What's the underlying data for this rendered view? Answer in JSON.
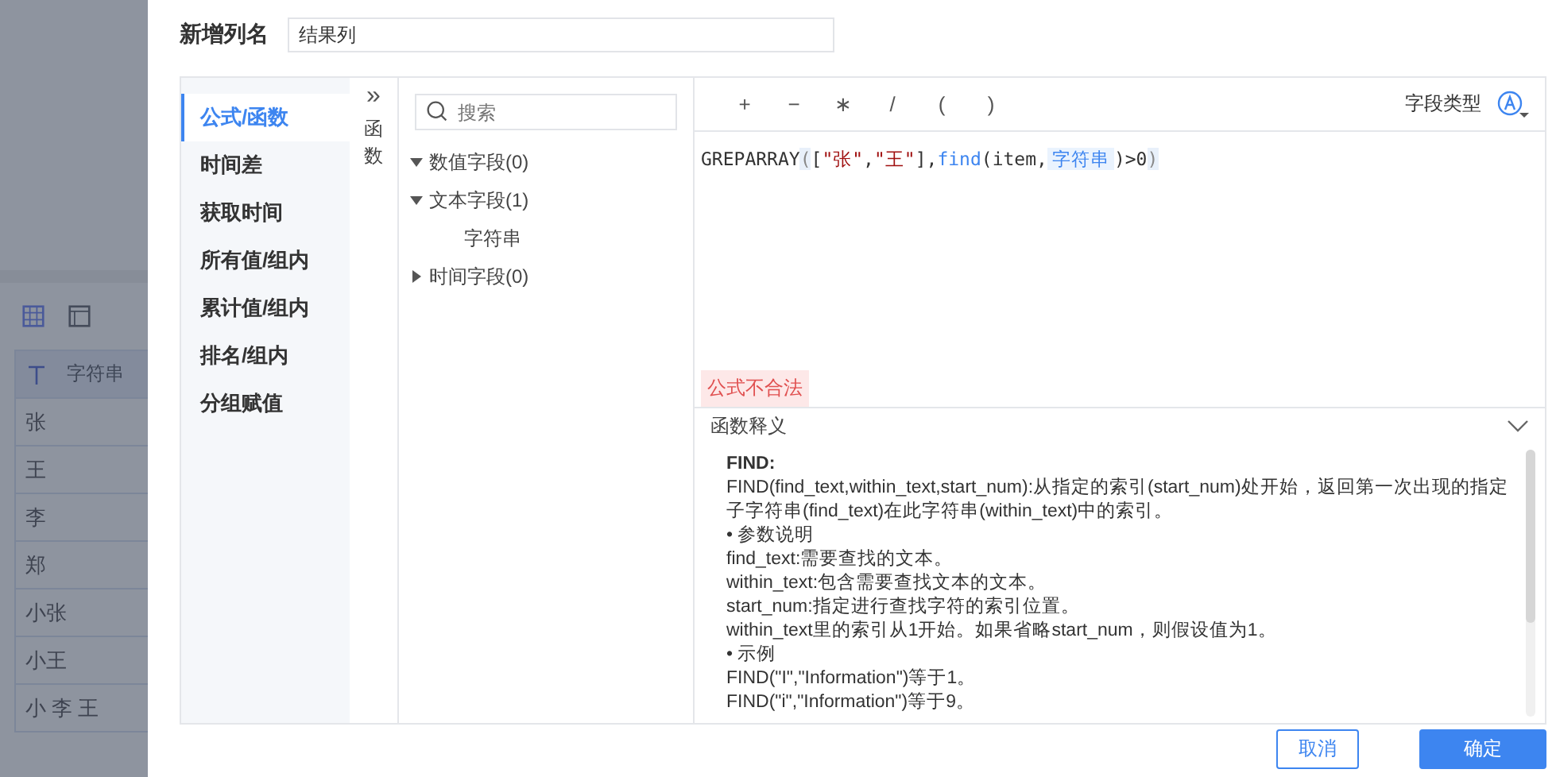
{
  "background": {
    "table": {
      "column": "字符串",
      "rows": [
        "张",
        "王",
        "李",
        "郑",
        "小张",
        "小王",
        "小 李 王"
      ]
    }
  },
  "dialog": {
    "name_label": "新增列名",
    "name_value": "结果列",
    "sidebar": {
      "items": [
        {
          "label": "公式/函数",
          "selected": true
        },
        {
          "label": "时间差",
          "selected": false
        },
        {
          "label": "获取时间",
          "selected": false
        },
        {
          "label": "所有值/组内",
          "selected": false
        },
        {
          "label": "累计值/组内",
          "selected": false
        },
        {
          "label": "排名/组内",
          "selected": false
        },
        {
          "label": "分组赋值",
          "selected": false
        }
      ]
    },
    "collapse": {
      "icon": "»",
      "label": "函数"
    },
    "fields": {
      "search_placeholder": "搜索",
      "tree": [
        {
          "label": "数值字段(0)",
          "expanded": true
        },
        {
          "label": "文本字段(1)",
          "expanded": true,
          "children": [
            {
              "label": "字符串"
            }
          ]
        },
        {
          "label": "时间字段(0)",
          "expanded": false
        }
      ]
    },
    "editor": {
      "operators": [
        "+",
        "−",
        "∗",
        "/",
        "(",
        ")"
      ],
      "field_type_label": "字段类型",
      "formula": [
        {
          "kind": "plain",
          "text": "GREPARRAY"
        },
        {
          "kind": "match",
          "text": "("
        },
        {
          "kind": "plain",
          "text": "["
        },
        {
          "kind": "string",
          "text": "\"张\""
        },
        {
          "kind": "plain",
          "text": ","
        },
        {
          "kind": "string",
          "text": "\"王\""
        },
        {
          "kind": "plain",
          "text": "],"
        },
        {
          "kind": "func",
          "text": "find"
        },
        {
          "kind": "plain",
          "text": "(item,"
        },
        {
          "kind": "field",
          "text": "字符串"
        },
        {
          "kind": "plain",
          "text": ")>0"
        },
        {
          "kind": "match",
          "text": ")"
        }
      ],
      "error": "公式不合法"
    },
    "help": {
      "title": "函数释义",
      "expanded": true,
      "lines": [
        {
          "kind": "heading",
          "text": "FIND:"
        },
        {
          "kind": "text",
          "text": "FIND(find_text,within_text,start_num):从指定的索引(start_num)处开始，返回第一次出现的指定子字符串(find_text)在此字符串(within_text)中的索引。"
        },
        {
          "kind": "bullet",
          "text": "• 参数说明"
        },
        {
          "kind": "text",
          "text": "find_text:需要查找的文本。"
        },
        {
          "kind": "text",
          "text": "within_text:包含需要查找文本的文本。"
        },
        {
          "kind": "text",
          "text": "start_num:指定进行查找字符的索引位置。"
        },
        {
          "kind": "text",
          "text": "within_text里的索引从1开始。如果省略start_num，则假设值为1。"
        },
        {
          "kind": "bullet",
          "text": "• 示例"
        },
        {
          "kind": "text",
          "text": "FIND(\"I\",\"Information\")等于1。"
        },
        {
          "kind": "text",
          "text": "FIND(\"i\",\"Information\")等于9。"
        }
      ]
    },
    "buttons": [
      {
        "label": "取消",
        "kind": "secondary"
      },
      {
        "label": "确定",
        "kind": "primary"
      }
    ]
  }
}
